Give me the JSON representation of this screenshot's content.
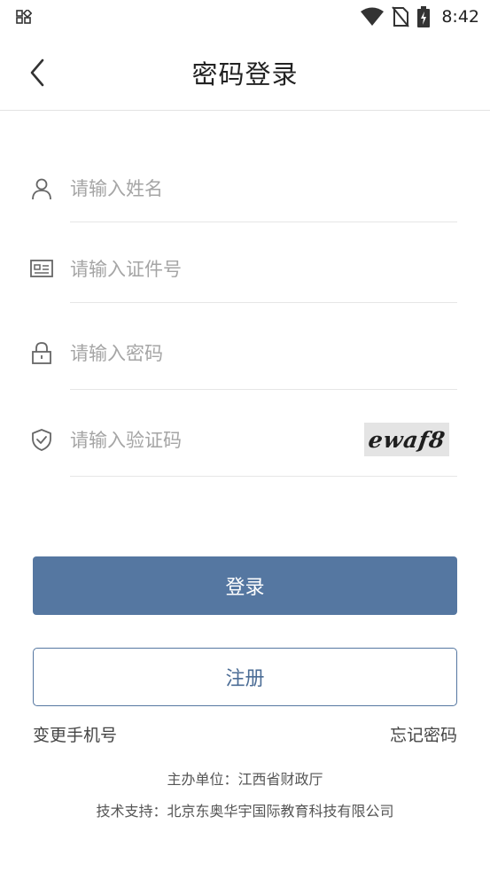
{
  "status_bar": {
    "time": "8:42"
  },
  "header": {
    "title": "密码登录"
  },
  "form": {
    "name_placeholder": "请输入姓名",
    "id_placeholder": "请输入证件号",
    "password_placeholder": "请输入密码",
    "captcha_placeholder": "请输入验证码",
    "captcha_text": "ewaf8"
  },
  "buttons": {
    "login": "登录",
    "register": "注册"
  },
  "links": {
    "change_phone": "变更手机号",
    "forgot_password": "忘记密码"
  },
  "footer": {
    "host": "主办单位：江西省财政厅",
    "support": "技术支持：北京东奥华宇国际教育科技有限公司"
  },
  "colors": {
    "primary": "#5577a1"
  }
}
